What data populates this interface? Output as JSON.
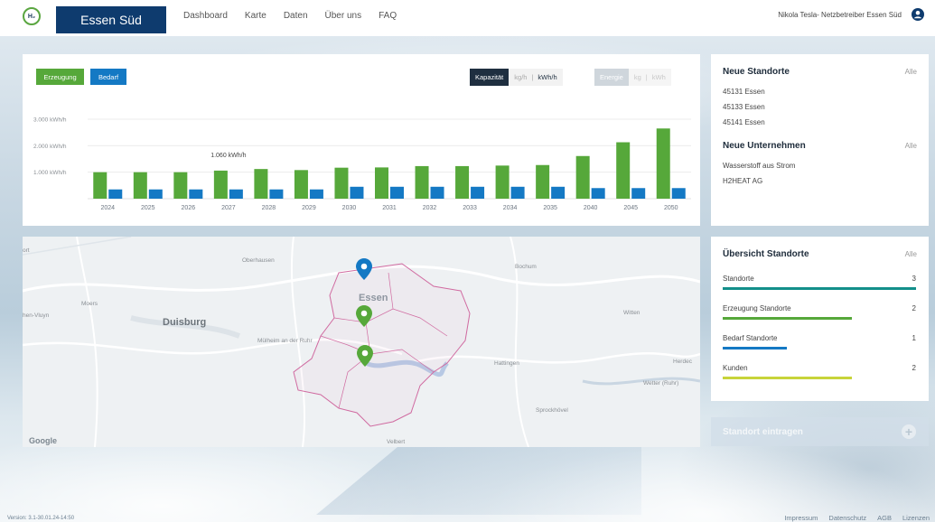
{
  "header": {
    "logo_text": "H₂",
    "region": "Essen Süd",
    "nav": [
      "Dashboard",
      "Karte",
      "Daten",
      "Über uns",
      "FAQ"
    ],
    "user": "Nikola Tesla- Netzbetreiber Essen Süd"
  },
  "chart_card": {
    "tab_erzeugung": "Erzeugung",
    "tab_bedarf": "Bedarf",
    "kapazitaet": "Kapazität",
    "kap_unit1": "kg/h",
    "kap_sep": "|",
    "kap_unit2": "kWh/h",
    "energie": "Energie",
    "en_unit1": "kg",
    "en_sep": "|",
    "en_unit2": "kWh"
  },
  "chart_data": {
    "type": "bar",
    "categories": [
      "2024",
      "2025",
      "2026",
      "2027",
      "2028",
      "2029",
      "2030",
      "2031",
      "2032",
      "2033",
      "2034",
      "2035",
      "2040",
      "2045",
      "2050"
    ],
    "series": [
      {
        "values": [
          1000,
          1000,
          1000,
          1060,
          1120,
          1080,
          1170,
          1180,
          1230,
          1230,
          1250,
          1270,
          1610,
          2130,
          2650
        ],
        "color": "#56a83a"
      },
      {
        "values": [
          350,
          350,
          350,
          350,
          350,
          350,
          450,
          450,
          450,
          450,
          450,
          450,
          400,
          400,
          400
        ],
        "color": "#1479c4"
      }
    ],
    "yticks": [
      {
        "value": 1000,
        "label": "1.000 kWh/h"
      },
      {
        "value": 2000,
        "label": "2.000 kWh/h"
      },
      {
        "value": 3000,
        "label": "3.000 kWh/h"
      }
    ],
    "annotation": {
      "category": "2027",
      "label": "1.060 kWh/h"
    },
    "ylim": [
      0,
      3000
    ],
    "grid": true
  },
  "neue_standorte": {
    "title": "Neue Standorte",
    "link": "Alle",
    "items": [
      "45131 Essen",
      "45133 Essen",
      "45141 Essen"
    ]
  },
  "neue_unternehmen": {
    "title": "Neue Unternehmen",
    "link": "Alle",
    "items": [
      "Wasserstoff aus Strom",
      "H2HEAT AG"
    ]
  },
  "uebersicht": {
    "title": "Übersicht Standorte",
    "link": "Alle",
    "rows": [
      {
        "label": "Standorte",
        "value": "3",
        "color": "#138f8a",
        "fraction": 1.0
      },
      {
        "label": "Erzeugung Standorte",
        "value": "2",
        "color": "#56a83a",
        "fraction": 0.67
      },
      {
        "label": "Bedarf Standorte",
        "value": "1",
        "color": "#1479c4",
        "fraction": 0.33
      },
      {
        "label": "Kunden",
        "value": "2",
        "color": "#c8d43a",
        "fraction": 0.67
      }
    ]
  },
  "map": {
    "places": {
      "oberhausen": "Oberhausen",
      "bochum": "Bochum",
      "moers": "Moers",
      "duisburg": "Duisburg",
      "essen": "Essen",
      "muelheim": "Mülheim an der Ruhr",
      "witten": "Witten",
      "hattingen": "Hattingen",
      "herdecke": "Herdec",
      "wetter": "Wetter (Ruhr)",
      "sprockhoevel": "Sprockhövel",
      "velbert": "Velbert",
      "vluyn": "hen-Vluyn",
      "ort": "ort"
    },
    "google": "Google",
    "pin_colors": {
      "blue": "#1479c4",
      "green": "#56a83a"
    }
  },
  "add_location": {
    "label": "Standort eintragen",
    "icon": "plus-icon"
  },
  "footer": {
    "version": "Version: 3.1-30.01.24-14:50",
    "links": [
      "Impressum",
      "Datenschutz",
      "AGB",
      "Lizenzen"
    ]
  }
}
